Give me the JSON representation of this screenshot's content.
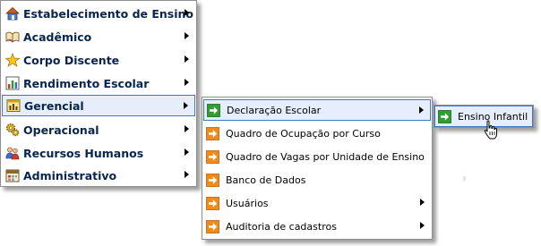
{
  "main_menu": {
    "items": [
      {
        "label": "Estabelecimento de Ensino",
        "icon": "house-icon"
      },
      {
        "label": "Acadêmico",
        "icon": "book-icon"
      },
      {
        "label": "Corpo Discente",
        "icon": "star-icon"
      },
      {
        "label": "Rendimento Escolar",
        "icon": "chart-icon"
      },
      {
        "label": "Gerencial",
        "icon": "chart-window-icon",
        "active": true
      },
      {
        "label": "Operacional",
        "icon": "gears-icon"
      },
      {
        "label": "Recursos Humanos",
        "icon": "people-icon"
      },
      {
        "label": "Administrativo",
        "icon": "calendar-icon"
      }
    ]
  },
  "gerencial_submenu": {
    "items": [
      {
        "label": "Declaração Escolar",
        "icon": "green-arrow-icon",
        "has_submenu": true,
        "active": true
      },
      {
        "label": "Quadro de Ocupação por Curso",
        "icon": "orange-arrow-icon",
        "has_submenu": false
      },
      {
        "label": "Quadro de Vagas por Unidade de Ensino",
        "icon": "orange-arrow-icon",
        "has_submenu": false
      },
      {
        "label": "Banco de Dados",
        "icon": "orange-arrow-icon",
        "has_submenu": false
      },
      {
        "label": "Usuários",
        "icon": "orange-arrow-icon",
        "has_submenu": true
      },
      {
        "label": "Auditoria de cadastros",
        "icon": "orange-arrow-icon",
        "has_submenu": true
      }
    ]
  },
  "declaracao_submenu": {
    "items": [
      {
        "label": "Ensino Infantil",
        "icon": "green-arrow-icon",
        "active": true
      }
    ]
  },
  "colors": {
    "highlight_bg": "#e6eefb",
    "highlight_border": "#4476c4",
    "main_text": "#08254f",
    "green_arrow": "#2f9e2f",
    "orange_arrow": "#ef8b1a"
  }
}
